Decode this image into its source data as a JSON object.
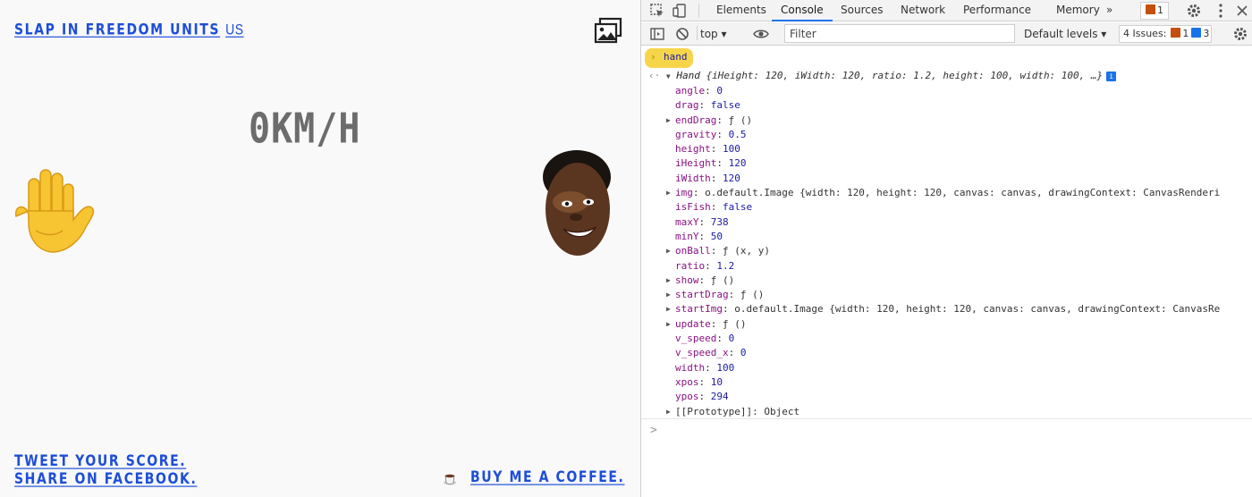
{
  "game": {
    "units_link": {
      "label": "SLAP IN FREEDOM UNITS",
      "suffix": "US"
    },
    "speed": "0KM/H",
    "tweet_label": "TWEET YOUR SCORE.",
    "share_label": "SHARE ON FACEBOOK.",
    "coffee_label": "BUY ME A COFFEE.",
    "image_toggle_icon": "image-icon",
    "hand_icon": "raised-hand-icon",
    "face_icon": "face-image",
    "link_color": "#1d4ed8"
  },
  "devtools": {
    "tabs": [
      "Elements",
      "Console",
      "Sources",
      "Network",
      "Performance",
      "Memory"
    ],
    "active_tab": "Console",
    "more_tabs": "»",
    "tab_issue_count": "1",
    "toolbar": {
      "context": "top",
      "filter_placeholder": "Filter",
      "levels": "Default levels",
      "issues_label": "4 Issues:",
      "issues_warn": "1",
      "issues_info": "3"
    },
    "console": {
      "input": "hand",
      "result_name": "Hand",
      "result_preview": "{iHeight: 120, iWidth: 120, ratio: 1.2, height: 100, width: 100, …}",
      "info_badge": "i",
      "properties": [
        {
          "key": "angle",
          "value": "0"
        },
        {
          "key": "drag",
          "value": "false"
        },
        {
          "key": "endDrag",
          "value": "ƒ ()",
          "expandable": true
        },
        {
          "key": "gravity",
          "value": "0.5"
        },
        {
          "key": "height",
          "value": "100"
        },
        {
          "key": "iHeight",
          "value": "120"
        },
        {
          "key": "iWidth",
          "value": "120"
        },
        {
          "key": "img",
          "value": "o.default.Image {width: 120, height: 120, canvas: canvas, drawingContext: CanvasRenderi",
          "expandable": true
        },
        {
          "key": "isFish",
          "value": "false"
        },
        {
          "key": "maxY",
          "value": "738"
        },
        {
          "key": "minY",
          "value": "50"
        },
        {
          "key": "onBall",
          "value": "ƒ (x, y)",
          "expandable": true
        },
        {
          "key": "ratio",
          "value": "1.2"
        },
        {
          "key": "show",
          "value": "ƒ ()",
          "expandable": true
        },
        {
          "key": "startDrag",
          "value": "ƒ ()",
          "expandable": true
        },
        {
          "key": "startImg",
          "value": "o.default.Image {width: 120, height: 120, canvas: canvas, drawingContext: CanvasRe",
          "expandable": true
        },
        {
          "key": "update",
          "value": "ƒ ()",
          "expandable": true
        },
        {
          "key": "v_speed",
          "value": "0"
        },
        {
          "key": "v_speed_x",
          "value": "0"
        },
        {
          "key": "width",
          "value": "100"
        },
        {
          "key": "xpos",
          "value": "10"
        },
        {
          "key": "ypos",
          "value": "294"
        },
        {
          "key": "[[Prototype]]",
          "value": "Object",
          "expandable": true,
          "proto": true
        }
      ],
      "prompt": ">"
    }
  }
}
